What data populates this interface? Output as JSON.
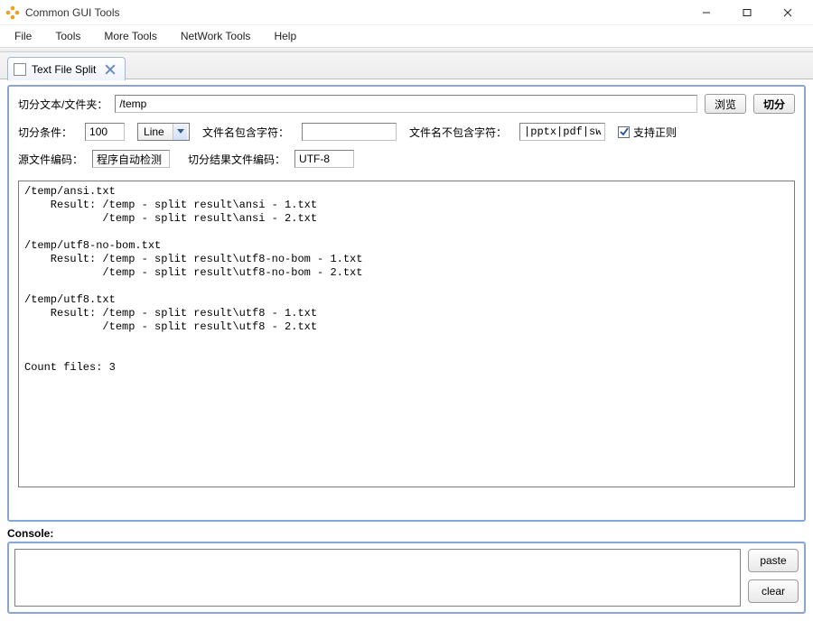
{
  "window": {
    "title": "Common GUI Tools"
  },
  "menus": [
    "File",
    "Tools",
    "More Tools",
    "NetWork Tools",
    "Help"
  ],
  "tab": {
    "label": "Text File Split"
  },
  "form": {
    "path_label": "切分文本/文件夹：",
    "path_value": "/temp",
    "browse_btn": "浏览",
    "split_btn": "切分",
    "cond_label": "切分条件：",
    "cond_count": "100",
    "cond_unit": "Line",
    "include_label": "文件名包含字符：",
    "include_value": "",
    "exclude_label": "文件名不包含字符：",
    "exclude_value": "|pptx|pdf|swf)$",
    "regex_label": "支持正则",
    "regex_checked": true,
    "src_enc_label": "源文件编码：",
    "src_enc_value": "程序自动检测",
    "dst_enc_label": "切分结果文件编码：",
    "dst_enc_value": "UTF-8"
  },
  "output_text": "/temp/ansi.txt\n    Result: /temp - split result\\ansi - 1.txt\n            /temp - split result\\ansi - 2.txt\n\n/temp/utf8-no-bom.txt\n    Result: /temp - split result\\utf8-no-bom - 1.txt\n            /temp - split result\\utf8-no-bom - 2.txt\n\n/temp/utf8.txt\n    Result: /temp - split result\\utf8 - 1.txt\n            /temp - split result\\utf8 - 2.txt\n\n\nCount files: 3",
  "console": {
    "label": "Console:",
    "paste_btn": "paste",
    "clear_btn": "clear"
  }
}
